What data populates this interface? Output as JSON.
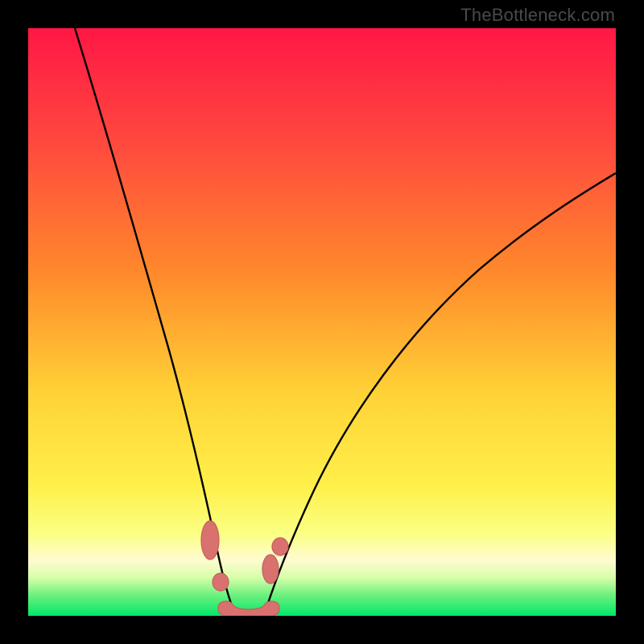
{
  "watermark": "TheBottleneck.com",
  "colors": {
    "frame": "#000000",
    "gradient_top": "#ff1745",
    "gradient_mid1": "#ff8a2b",
    "gradient_mid2": "#ffe43a",
    "gradient_low": "#f7ff6e",
    "gradient_cream": "#fffbd0",
    "gradient_green": "#00e867",
    "curve_stroke": "#000000",
    "marker_fill": "#d9726f",
    "marker_stroke": "#c2605d"
  },
  "chart_data": {
    "type": "line",
    "title": "",
    "xlabel": "",
    "ylabel": "",
    "x_range": [
      0,
      100
    ],
    "y_range": [
      0,
      100
    ],
    "series": [
      {
        "name": "left-curve",
        "x": [
          8,
          12,
          16,
          20,
          24,
          27,
          29.5,
          31,
          32.5,
          34
        ],
        "y": [
          100,
          86,
          72,
          58,
          44,
          30,
          18,
          10,
          4,
          0.5
        ]
      },
      {
        "name": "right-curve",
        "x": [
          40,
          42,
          45,
          50,
          56,
          64,
          74,
          86,
          100
        ],
        "y": [
          0.5,
          5,
          12,
          22,
          33,
          44,
          54,
          62,
          68
        ]
      },
      {
        "name": "floor-segment",
        "x": [
          34,
          36,
          38,
          40
        ],
        "y": [
          0.5,
          0.5,
          0.5,
          0.5
        ]
      }
    ],
    "markers": [
      {
        "shape": "tall-blob",
        "cx": 31.0,
        "cy": 9.0,
        "rx": 1.6,
        "ry": 3.6
      },
      {
        "shape": "round",
        "cx": 32.7,
        "cy": 3.0,
        "rx": 1.4,
        "ry": 1.5
      },
      {
        "shape": "tall-blob",
        "cx": 41.2,
        "cy": 5.4,
        "rx": 1.4,
        "ry": 2.6
      },
      {
        "shape": "round",
        "cx": 42.8,
        "cy": 9.6,
        "rx": 1.4,
        "ry": 1.6
      },
      {
        "shape": "floor-blob",
        "cx": 34.0,
        "cy": 0.9,
        "rx": 1.8,
        "ry": 1.4
      },
      {
        "shape": "floor-blob",
        "cx": 37.0,
        "cy": 0.9,
        "rx": 2.2,
        "ry": 1.4
      },
      {
        "shape": "floor-blob",
        "cx": 40.0,
        "cy": 0.9,
        "rx": 1.8,
        "ry": 1.4
      }
    ]
  }
}
